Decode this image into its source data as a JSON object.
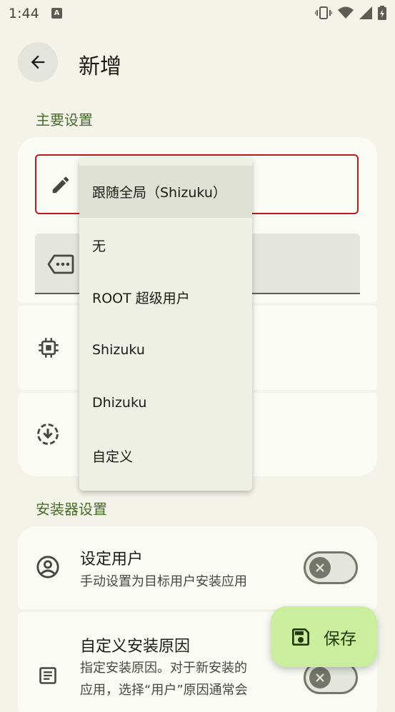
{
  "status_bar": {
    "time": "1:44",
    "notification_badge": "A"
  },
  "header": {
    "title": "新增"
  },
  "sections": {
    "main": "主要设置",
    "installer": "安装器设置"
  },
  "dropdown": {
    "items": [
      {
        "label": "跟随全局（Shizuku）",
        "selected": true
      },
      {
        "label": "无"
      },
      {
        "label": "ROOT 超级用户"
      },
      {
        "label": "Shizuku"
      },
      {
        "label": "Dhizuku"
      },
      {
        "label": "自定义"
      }
    ]
  },
  "installer": {
    "user": {
      "title": "设定用户",
      "subtitle": "手动设置为目标用户安装应用",
      "enabled": false
    },
    "reason": {
      "title": "自定义安装原因",
      "subtitle_line1": "指定安装原因。对于新安装的",
      "subtitle_line2": "应用，选择“用户”原因通常会",
      "enabled": false
    }
  },
  "fab": {
    "label": "保存"
  },
  "colors": {
    "accent": "#4b6b2d",
    "error": "#ba1a1a",
    "fab": "#c8ee9e",
    "background": "#f3f3ea"
  }
}
